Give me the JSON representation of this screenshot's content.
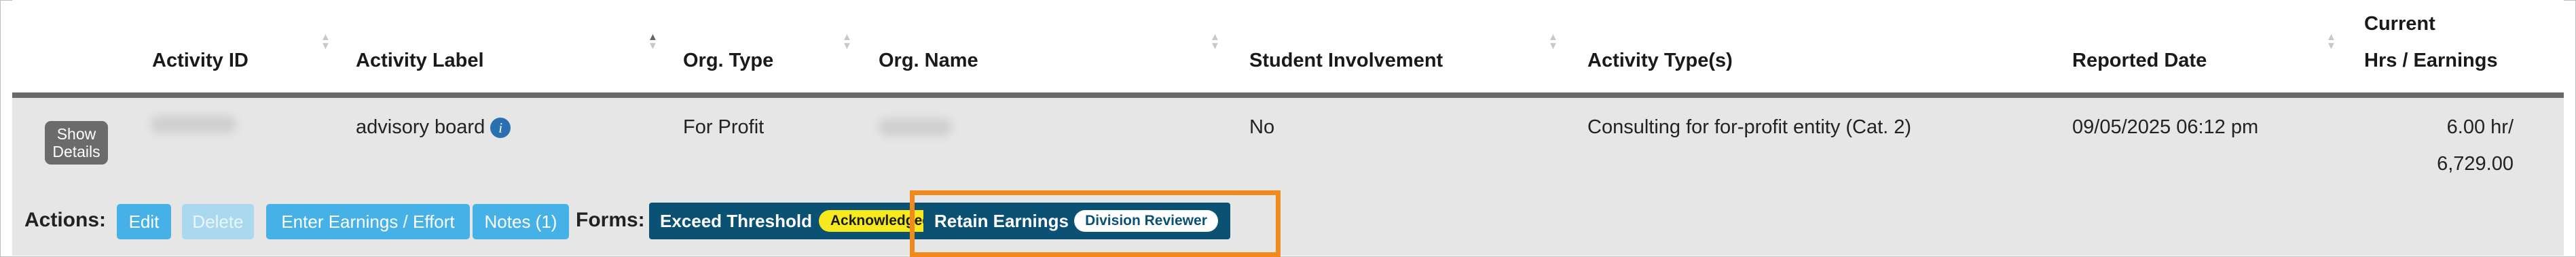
{
  "columns": {
    "activity_id": "Activity ID",
    "activity_label": "Activity Label",
    "org_type": "Org. Type",
    "org_name": "Org. Name",
    "student_involvement": "Student Involvement",
    "activity_types": "Activity Type(s)",
    "reported_date": "Reported Date",
    "current_line1": "Current",
    "current_line2": "Hrs / Earnings"
  },
  "row": {
    "show_details_line1": "Show",
    "show_details_line2": "Details",
    "activity_label": "advisory board",
    "info_icon_glyph": "i",
    "org_type": "For Profit",
    "student_involvement": "No",
    "activity_type": "Consulting for for-profit entity (Cat. 2)",
    "reported_date": "09/05/2025 06:12 pm",
    "hours": "6.00 hr/",
    "earnings": "6,729.00"
  },
  "actions": {
    "label": "Actions:",
    "edit": "Edit",
    "delete": "Delete",
    "enter_earnings": "Enter Earnings / Effort",
    "notes": "Notes (1)"
  },
  "forms": {
    "label": "Forms:",
    "exceed_threshold": "Exceed Threshold",
    "exceed_threshold_status": "Acknowledged",
    "retain_earnings": "Retain Earnings",
    "retain_earnings_status": "Division Reviewer"
  },
  "icons": {
    "sort": "sort-icon",
    "info": "info-icon"
  },
  "colors": {
    "action_button": "#46b1e6",
    "form_button": "#0a5173",
    "status_acknowledged": "#f6ea1e",
    "highlight": "#f08a1c",
    "info_icon": "#2a6fb0"
  }
}
